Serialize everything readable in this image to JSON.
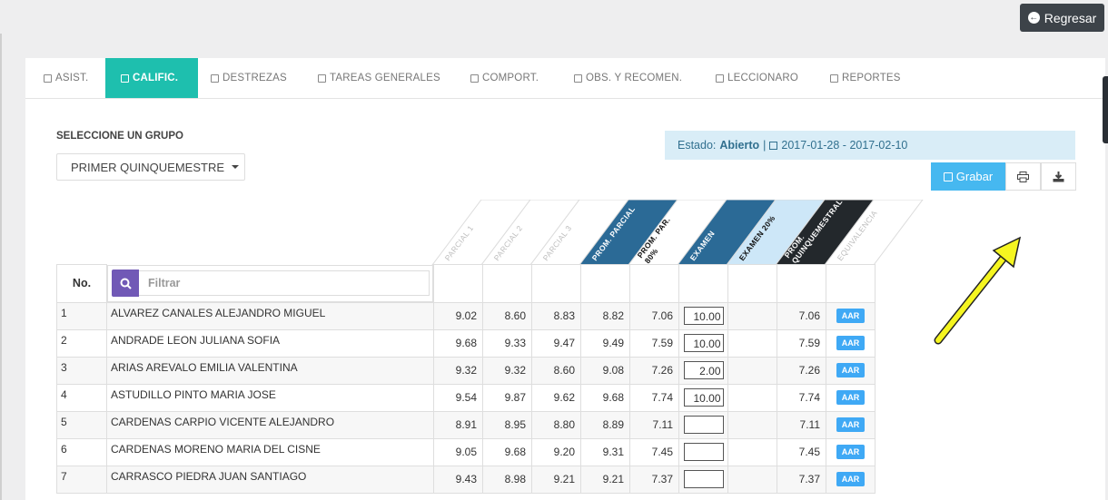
{
  "topbar": {
    "regresar_label": "Regresar"
  },
  "tabs": [
    {
      "label": "ASIST.",
      "icon": "calendar-icon"
    },
    {
      "label": "CALIFIC.",
      "icon": "sort-icon",
      "active": true
    },
    {
      "label": "DESTREZAS",
      "icon": "edit-icon"
    },
    {
      "label": "TAREAS GENERALES",
      "icon": "edit-icon"
    },
    {
      "label": "COMPORT.",
      "icon": "message-icon"
    },
    {
      "label": "OBS. Y RECOMEN.",
      "icon": "comments-icon"
    },
    {
      "label": "LECCIONARO",
      "icon": "book-icon"
    },
    {
      "label": "REPORTES",
      "icon": "bar-chart-icon"
    }
  ],
  "grupo": {
    "label": "SELECCIONE UN GRUPO",
    "selected": "PRIMER QUINQUEMESTRE"
  },
  "estado": {
    "prefix": "Estado:",
    "value": "Abierto",
    "separator": "|",
    "dates": "2017-01-28 - 2017-02-10"
  },
  "actions": {
    "grabar_label": "Grabar",
    "print_icon": "print-icon",
    "download_icon": "download-icon"
  },
  "table": {
    "no_header": "No.",
    "filter_placeholder": "Filtrar",
    "columns": [
      "PARCIAL 1",
      "PARCIAL 2",
      "PARCIAL 3",
      "PROM. PARCIAL",
      "PROM. PAR. 80%",
      "EXAMEN",
      "EXAMEN 20%",
      "PROM. QUINQUEMESTRAL",
      "EQUIVALENCIA"
    ],
    "column_colors": [
      "#ffffff",
      "#ffffff",
      "#ffffff",
      "#2b6a96",
      "#ffffff",
      "#2b6a96",
      "#cde7f8",
      "#23282c",
      "#ffffff"
    ],
    "rows": [
      {
        "no": "1",
        "name": "ALVAREZ CANALES ALEJANDRO MIGUEL",
        "p1": "9.02",
        "p2": "8.60",
        "p3": "8.83",
        "prom": "8.82",
        "p80": "7.06",
        "exam": "10.00",
        "e20": "",
        "quin": "7.06",
        "eq": "AAR"
      },
      {
        "no": "2",
        "name": "ANDRADE LEON JULIANA SOFIA",
        "p1": "9.68",
        "p2": "9.33",
        "p3": "9.47",
        "prom": "9.49",
        "p80": "7.59",
        "exam": "10.00",
        "e20": "",
        "quin": "7.59",
        "eq": "AAR"
      },
      {
        "no": "3",
        "name": "ARIAS AREVALO EMILIA VALENTINA",
        "p1": "9.32",
        "p2": "9.32",
        "p3": "8.60",
        "prom": "9.08",
        "p80": "7.26",
        "exam": "2.00",
        "e20": "",
        "quin": "7.26",
        "eq": "AAR"
      },
      {
        "no": "4",
        "name": "ASTUDILLO PINTO MARIA JOSE",
        "p1": "9.54",
        "p2": "9.87",
        "p3": "9.62",
        "prom": "9.68",
        "p80": "7.74",
        "exam": "10.00",
        "e20": "",
        "quin": "7.74",
        "eq": "AAR"
      },
      {
        "no": "5",
        "name": "CARDENAS CARPIO VICENTE ALEJANDRO",
        "p1": "8.91",
        "p2": "8.95",
        "p3": "8.80",
        "prom": "8.89",
        "p80": "7.11",
        "exam": "",
        "e20": "",
        "quin": "7.11",
        "eq": "AAR"
      },
      {
        "no": "6",
        "name": "CARDENAS MORENO MARIA DEL CISNE",
        "p1": "9.05",
        "p2": "9.68",
        "p3": "9.20",
        "prom": "9.31",
        "p80": "7.45",
        "exam": "",
        "e20": "",
        "quin": "7.45",
        "eq": "AAR"
      },
      {
        "no": "7",
        "name": "CARRASCO PIEDRA JUAN SANTIAGO",
        "p1": "9.43",
        "p2": "8.98",
        "p3": "9.21",
        "prom": "9.21",
        "p80": "7.37",
        "exam": "",
        "e20": "",
        "quin": "7.37",
        "eq": "AAR"
      }
    ]
  },
  "annotation": {
    "arrow_color": "#f5f520"
  }
}
